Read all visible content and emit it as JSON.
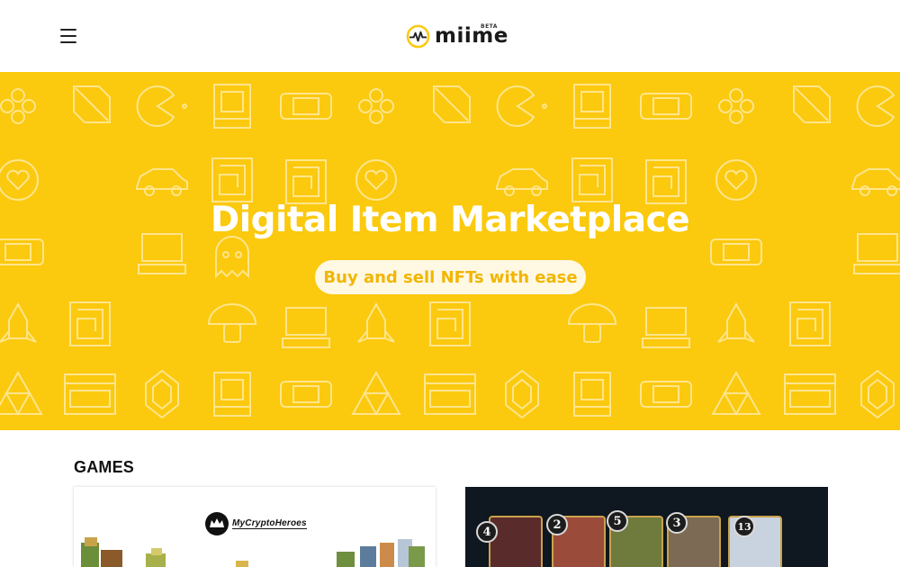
{
  "header": {
    "menu_label": "",
    "logo_text": "miime",
    "logo_badge": "BETA",
    "brand_color": "#fbc90e"
  },
  "hero": {
    "title": "Digital Item Marketplace",
    "cta_label": "Buy and sell NFTs with ease",
    "background_color": "#fbc90e"
  },
  "games": {
    "heading": "GAMES",
    "cards": [
      {
        "name": "MyCryptoHeroes",
        "logo_text": "MyCryptoHeroes"
      },
      {
        "name": "trading-card-game",
        "card_costs": [
          "4",
          "2",
          "5",
          "3",
          "13"
        ]
      }
    ]
  },
  "icons": [
    "hamburger-menu-icon",
    "miime-logo-icon",
    "gamepad-icon",
    "sword-shield-icon",
    "pacman-icon",
    "arcade-cabinet-icon",
    "handheld-console-icon",
    "heart-icon",
    "car-icon",
    "joystick-icon",
    "maze-icon",
    "computer-icon",
    "ghost-icon",
    "mushroom-icon",
    "rocket-icon",
    "triforce-icon",
    "gem-icon",
    "game-over-icon",
    "1up-icon"
  ]
}
